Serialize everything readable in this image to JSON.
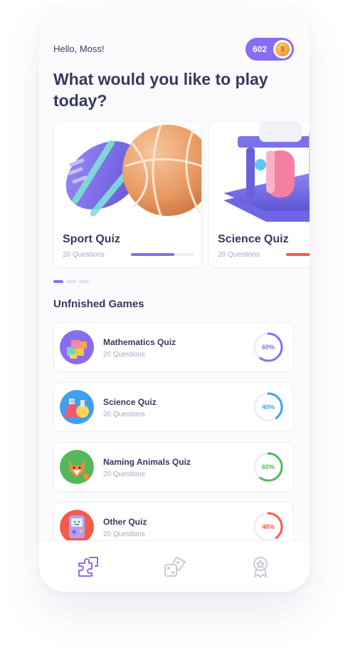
{
  "header": {
    "greeting": "Hello, Moss!",
    "coins": "602",
    "headline": "What would you like to play today?"
  },
  "featured": [
    {
      "title": "Sport Quiz",
      "subtitle": "20 Questions",
      "progress": 0.68,
      "color": "#8a6cf0",
      "icon": "football-basketball-illustration"
    },
    {
      "title": "Science Quiz",
      "subtitle": "20 Questions",
      "progress": 0.6,
      "color": "#f25c4a",
      "icon": "test-tube-illustration"
    }
  ],
  "carousel": {
    "pages": 3,
    "active": 0
  },
  "unfinished": {
    "title": "Unfnished Games",
    "items": [
      {
        "title": "Mathematics Quiz",
        "subtitle": "20 Questions",
        "percent": "60%",
        "value": 0.6,
        "color": "#8a6cf0",
        "icon": "cubes-icon"
      },
      {
        "title": "Science Quiz",
        "subtitle": "20 Questions",
        "percent": "40%",
        "value": 0.4,
        "color": "#3fa0ee",
        "icon": "flasks-icon"
      },
      {
        "title": "Naming Animals Quiz",
        "subtitle": "20 Questions",
        "percent": "60%",
        "value": 0.6,
        "color": "#54b85a",
        "icon": "fox-icon"
      },
      {
        "title": "Other Quiz",
        "subtitle": "20 Questions",
        "percent": "40%",
        "value": 0.4,
        "color": "#f25c4a",
        "icon": "gameboy-icon"
      }
    ]
  },
  "tabs": [
    {
      "name": "puzzle-icon",
      "active": true
    },
    {
      "name": "dice-icon",
      "active": false
    },
    {
      "name": "award-icon",
      "active": false
    }
  ]
}
